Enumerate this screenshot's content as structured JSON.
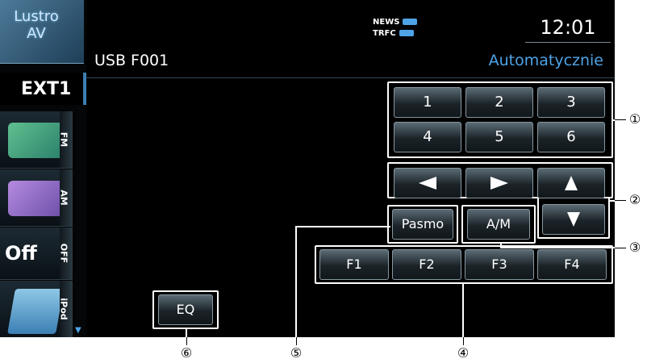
{
  "source_bar": {
    "mirror_line1": "Lustro",
    "mirror_line2": "AV",
    "ext_label": "EXT1",
    "fm_label": "FM",
    "am_label": "AM",
    "off_label": "Off",
    "off_tab_label": "OFF",
    "ipod_label": "iPod"
  },
  "header": {
    "clock": "12:01",
    "news_label": "NEWS",
    "trfc_label": "TRFC",
    "title": "USB F001",
    "mode": "Automatycznie"
  },
  "keypad": [
    "1",
    "2",
    "3",
    "4",
    "5",
    "6"
  ],
  "buttons": {
    "pasmo": "Pasmo",
    "am_fm": "A/M",
    "f1": "F1",
    "f2": "F2",
    "f3": "F3",
    "f4": "F4",
    "eq": "EQ"
  },
  "callouts": [
    "①",
    "②",
    "③",
    "④",
    "⑤",
    "⑥"
  ]
}
